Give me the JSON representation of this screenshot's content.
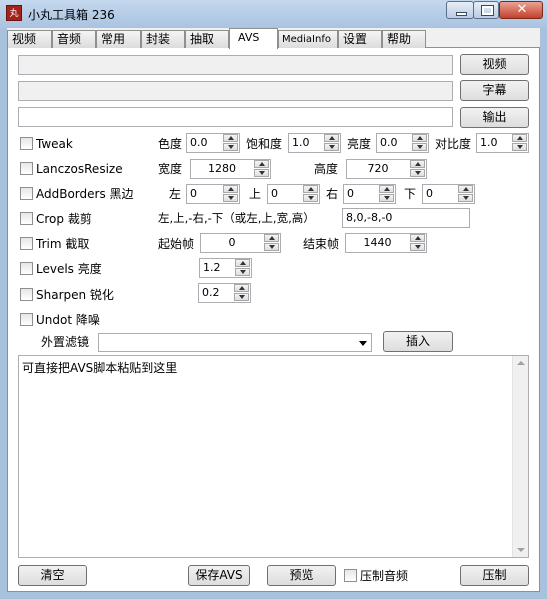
{
  "window": {
    "title": "小丸工具箱 236",
    "icon_text": "丸"
  },
  "tabs": [
    {
      "label": "视频"
    },
    {
      "label": "音频"
    },
    {
      "label": "常用"
    },
    {
      "label": "封装"
    },
    {
      "label": "抽取"
    },
    {
      "label": "AVS"
    },
    {
      "label": "MediaInfo"
    },
    {
      "label": "设置"
    },
    {
      "label": "帮助"
    }
  ],
  "active_tab": "AVS",
  "io": {
    "video_button": "视频",
    "subtitle_button": "字幕",
    "output_button": "输出"
  },
  "tweak": {
    "label": "Tweak",
    "hue_label": "色度",
    "hue": "0.0",
    "saturation_label": "饱和度",
    "saturation": "1.0",
    "brightness_label": "亮度",
    "brightness": "0.0",
    "contrast_label": "对比度",
    "contrast": "1.0"
  },
  "resize": {
    "label": "LanczosResize",
    "width_label": "宽度",
    "width": "1280",
    "height_label": "高度",
    "height": "720"
  },
  "borders": {
    "label": "AddBorders 黑边",
    "left_label": "左",
    "left": "0",
    "top_label": "上",
    "top": "0",
    "right_label": "右",
    "right": "0",
    "bottom_label": "下",
    "bottom": "0"
  },
  "crop": {
    "label": "Crop 裁剪",
    "hint": "左,上,-右,-下（或左,上,宽,高）",
    "value": "8,0,-8,-0"
  },
  "trim": {
    "label": "Trim 截取",
    "start_label": "起始帧",
    "start": "0",
    "end_label": "结束帧",
    "end": "1440"
  },
  "levels": {
    "label": "Levels 亮度",
    "value": "1.2"
  },
  "sharpen": {
    "label": "Sharpen 锐化",
    "value": "0.2"
  },
  "undot": {
    "label": "Undot 降噪"
  },
  "filter": {
    "label": "外置滤镜",
    "selected": "",
    "insert_button": "插入"
  },
  "script": {
    "text": "可直接把AVS脚本粘贴到这里"
  },
  "bottom": {
    "clear_button": "清空",
    "save_button": "保存AVS",
    "preview_button": "预览",
    "compress_audio_label": "压制音频",
    "encode_button": "压制"
  }
}
